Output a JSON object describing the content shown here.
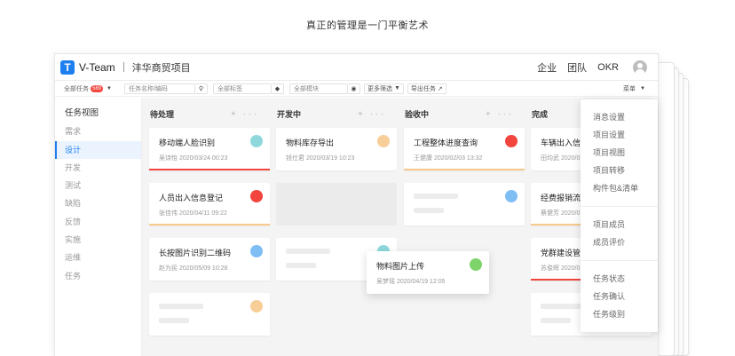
{
  "tagline": "真正的管理是一门平衡艺术",
  "app": {
    "logo_letter": "T",
    "name": "V-Team",
    "project": "沣华商贸项目",
    "nav": [
      "企业",
      "团队",
      "OKR"
    ]
  },
  "filters": {
    "all_tasks": "全部任务",
    "all_tasks_count": "589",
    "task_name_placeholder": "任务名称/编码",
    "all_tags": "全部标签",
    "all_modules": "全部模块",
    "more_filters": "更多筛选",
    "export_tasks": "导出任务",
    "menu": "菜单"
  },
  "sidebar": {
    "heading": "任务视图",
    "items": [
      "需求",
      "设计",
      "开发",
      "测试",
      "缺陷",
      "反馈",
      "实施",
      "运维",
      "任务"
    ],
    "active_index": 1
  },
  "columns": [
    {
      "title": "待处理",
      "cards": [
        {
          "title": "移动端人脸识别",
          "meta": "吴诗怡 2020/03/24 00:23",
          "dot": "#8ed8dc",
          "bar": "#f2453d"
        },
        {
          "title": "人员出入信息登记",
          "meta": "张佳伟 2020/04/11 09:22",
          "dot": "#f2453d",
          "bar": "#f7c98b"
        },
        {
          "title": "长按图片识别二维码",
          "meta": "赵为民 2020/05/09 10:28",
          "dot": "#7fbef5",
          "bar": ""
        }
      ]
    },
    {
      "title": "开发中",
      "cards": [
        {
          "title": "物料库存导出",
          "meta": "钱仕君 2020/03/19 10:23",
          "dot": "#f8ce98",
          "bar": ""
        }
      ]
    },
    {
      "title": "验收中",
      "cards": [
        {
          "title": "工程整体进度查询",
          "meta": "王健康 2020/02/03 13:32",
          "dot": "#f2453d",
          "bar": "#f7c98b"
        }
      ]
    },
    {
      "title": "完成",
      "cards": [
        {
          "title": "车辆出入信",
          "meta": "田均武 2020/0",
          "dot": "",
          "bar": ""
        },
        {
          "title": "经费报销流",
          "meta": "蔡健芳 2020/0",
          "dot": "",
          "bar": "#f7c98b"
        },
        {
          "title": "党群建设管",
          "meta": "苏俊辉 2020/0",
          "dot": "",
          "bar": "#f2453d"
        }
      ]
    }
  ],
  "dragging_card": {
    "title": "物料图片上传",
    "meta": "吴梦瑶 2020/04/19 12:05",
    "dot": "#7ed36b"
  },
  "placeholder_dots": [
    "#f8ce98",
    "#7fbef5",
    "#8ed8dc"
  ],
  "menu_groups": [
    [
      "消息设置",
      "项目设置",
      "项目视图",
      "项目转移",
      "构件包&清单"
    ],
    [
      "项目成员",
      "成员评价"
    ],
    [
      "任务状态",
      "任务确认",
      "任务级别"
    ]
  ]
}
